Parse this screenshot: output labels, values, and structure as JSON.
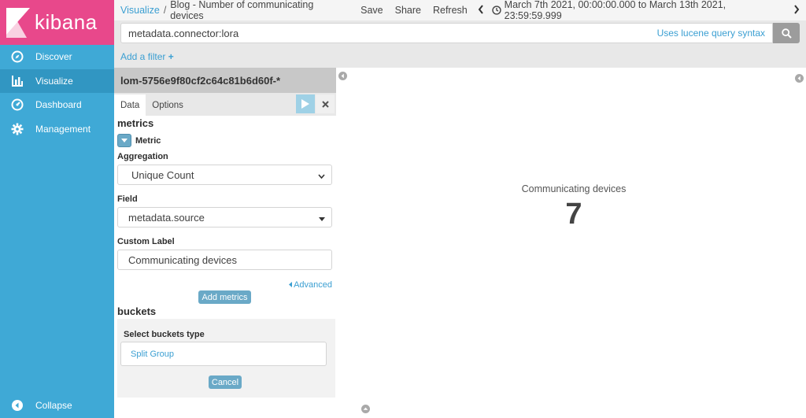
{
  "brand": {
    "name": "kibana"
  },
  "sidebar": {
    "items": [
      {
        "label": "Discover",
        "icon": "compass-icon"
      },
      {
        "label": "Visualize",
        "icon": "bar-chart-icon"
      },
      {
        "label": "Dashboard",
        "icon": "dashboard-icon"
      },
      {
        "label": "Management",
        "icon": "gear-icon"
      }
    ],
    "collapse_label": "Collapse"
  },
  "topbar": {
    "breadcrumb_root": "Visualize",
    "breadcrumb_sep": "/",
    "title": "Blog - Number of communicating devices",
    "save": "Save",
    "share": "Share",
    "refresh": "Refresh",
    "time_range": "March 7th 2021, 00:00:00.000 to March 13th 2021, 23:59:59.999"
  },
  "query": {
    "value": "metadata.connector:lora",
    "lucene_link": "Uses lucene query syntax"
  },
  "filter": {
    "add_label": "Add a filter",
    "add_icon": "+"
  },
  "editor": {
    "index_pattern": "lom-5756e9f80cf2c64c81b6d60f-*",
    "tabs": [
      "Data",
      "Options"
    ],
    "metrics_title": "metrics",
    "metric_label": "Metric",
    "aggregation_label": "Aggregation",
    "aggregation_value": "Unique Count",
    "field_label": "Field",
    "field_value": "metadata.source",
    "custom_label_label": "Custom Label",
    "custom_label_value": "Communicating devices",
    "advanced_label": "Advanced",
    "add_metrics_label": "Add metrics",
    "buckets_title": "buckets",
    "select_buckets_label": "Select buckets type",
    "bucket_option": "Split Group",
    "cancel_label": "Cancel"
  },
  "visualization": {
    "label": "Communicating devices",
    "value": "7"
  },
  "colors": {
    "sidebar": "#3fa9d6",
    "sidebar_active": "#3196c2",
    "brand": "#e8488b",
    "link": "#3b9fd2",
    "button": "#6aa9c7"
  }
}
